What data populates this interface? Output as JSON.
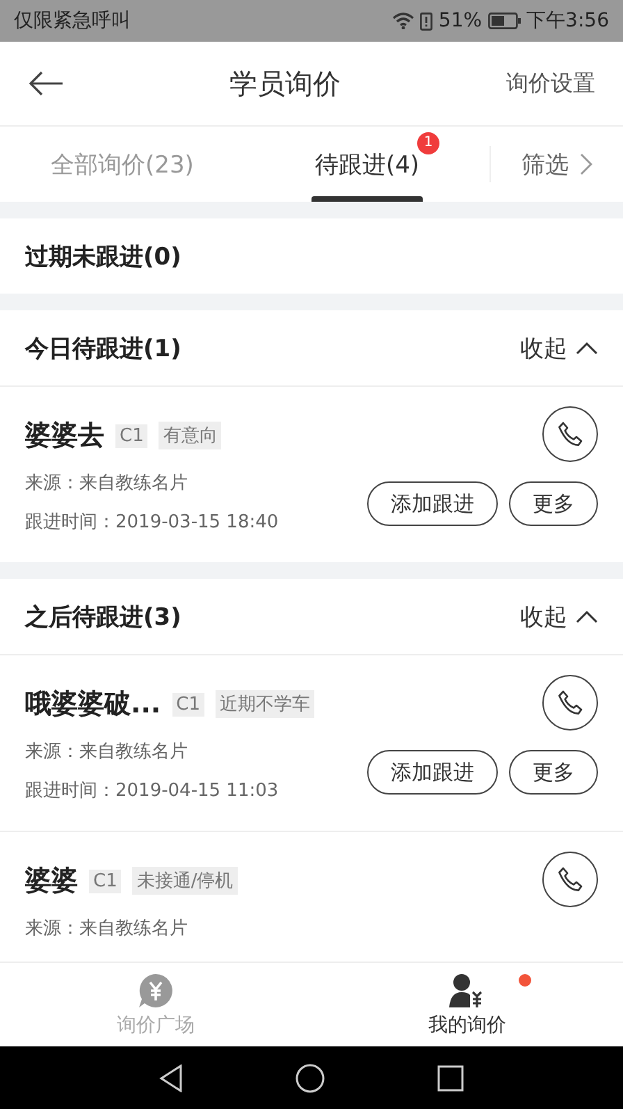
{
  "status_bar": {
    "notice": "仅限紧急呼叫",
    "battery": "51%",
    "time": "下午3:56"
  },
  "header": {
    "title": "学员询价",
    "action": "询价设置"
  },
  "tabs": [
    {
      "label": "全部询价(23)",
      "selected": false
    },
    {
      "label": "待跟进(4)",
      "selected": true,
      "badge": "1"
    }
  ],
  "filter": {
    "label": "筛选"
  },
  "sections": [
    {
      "title": "过期未跟进(0)"
    },
    {
      "title": "今日待跟进(1)",
      "expanded": true,
      "toggle": "收起",
      "cards": [
        {
          "name": "婆婆去",
          "tags": [
            "C1",
            "有意向"
          ],
          "source": "来源：来自教练名片",
          "time": "跟进时间：2019-03-15 18:40",
          "buttons": [
            "添加跟进",
            "更多"
          ]
        }
      ]
    },
    {
      "title": "之后待跟进(3)",
      "expanded": true,
      "toggle": "收起",
      "cards": [
        {
          "name": "哦婆婆破...",
          "tags": [
            "C1",
            "近期不学车"
          ],
          "source": "来源：来自教练名片",
          "time": "跟进时间：2019-04-15 11:03",
          "buttons": [
            "添加跟进",
            "更多"
          ]
        },
        {
          "name": "婆婆",
          "tags": [
            "C1",
            "未接通/停机"
          ],
          "source": "来源：来自教练名片"
        }
      ]
    }
  ],
  "bottom_nav": [
    {
      "label": "询价广场",
      "kind": "plaza",
      "selected": false,
      "dot": false
    },
    {
      "label": "我的询价",
      "kind": "mine",
      "selected": true,
      "dot": true
    }
  ]
}
